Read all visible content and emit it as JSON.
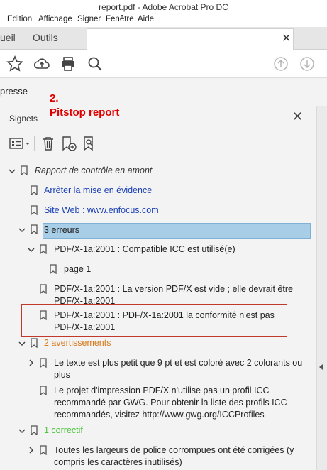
{
  "window": {
    "title": "report.pdf - Adobe Acrobat Pro DC"
  },
  "menu": [
    "Edition",
    "Affichage",
    "Signer",
    "Fenêtre",
    "Aide"
  ],
  "tabs": {
    "home": "ueil",
    "tools": "Outils"
  },
  "toolbar": {
    "icons": [
      "star-icon",
      "cloud-upload-icon",
      "print-icon",
      "search-zoom-icon",
      "page-up-icon",
      "page-down-icon"
    ]
  },
  "side": {
    "label": "presse"
  },
  "annotation": {
    "number": "2.",
    "text": "Pitstop report",
    "color": "#e00000"
  },
  "panel": {
    "title": "Signets",
    "tools": [
      "options-menu-icon",
      "delete-icon",
      "new-bookmark-icon",
      "bookmark-search-icon"
    ]
  },
  "tree": {
    "root": "Rapport de contrôle en amont",
    "stop_highlight": "Arrêter la mise en évidence",
    "website": "Site Web : www.enfocus.com",
    "errors": "3 erreurs",
    "err1": "PDF/X-1a:2001 : Compatible ICC est utilisé(e)",
    "page1": "page 1",
    "err2_l1": "PDF/X-1a:2001 : La version PDF/X est vide ; elle devrait être",
    "err2_l2": "PDF/X-1a:2001",
    "err3_l1": "PDF/X-1a:2001 : PDF/X-1a:2001 la conformité n'est pas",
    "err3_l2": "PDF/X-1a:2001",
    "warnings": "2 avertissements",
    "warn1_l1": "Le texte est plus petit que 9 pt et est coloré avec 2 colorants ou",
    "warn1_l2": "plus",
    "warn2_l1": "Le projet d'impression PDF/X n'utilise pas un profil ICC",
    "warn2_l2": "recommandé par GWG. Pour obtenir la liste des profils ICC",
    "warn2_l3": "recommandés, visitez http://www.gwg.org/ICCProfiles",
    "fixes": "1 correctif",
    "fix1_l1": "Toutes les largeurs de police corrompues ont été corrigées (y",
    "fix1_l2": "compris les caractères inutilisés)"
  },
  "colors": {
    "link": "#1a3fb5",
    "warning": "#d67a1b",
    "fix": "#49c43a",
    "selection": "#a8cde6",
    "highlight_box": "#c0392b"
  }
}
